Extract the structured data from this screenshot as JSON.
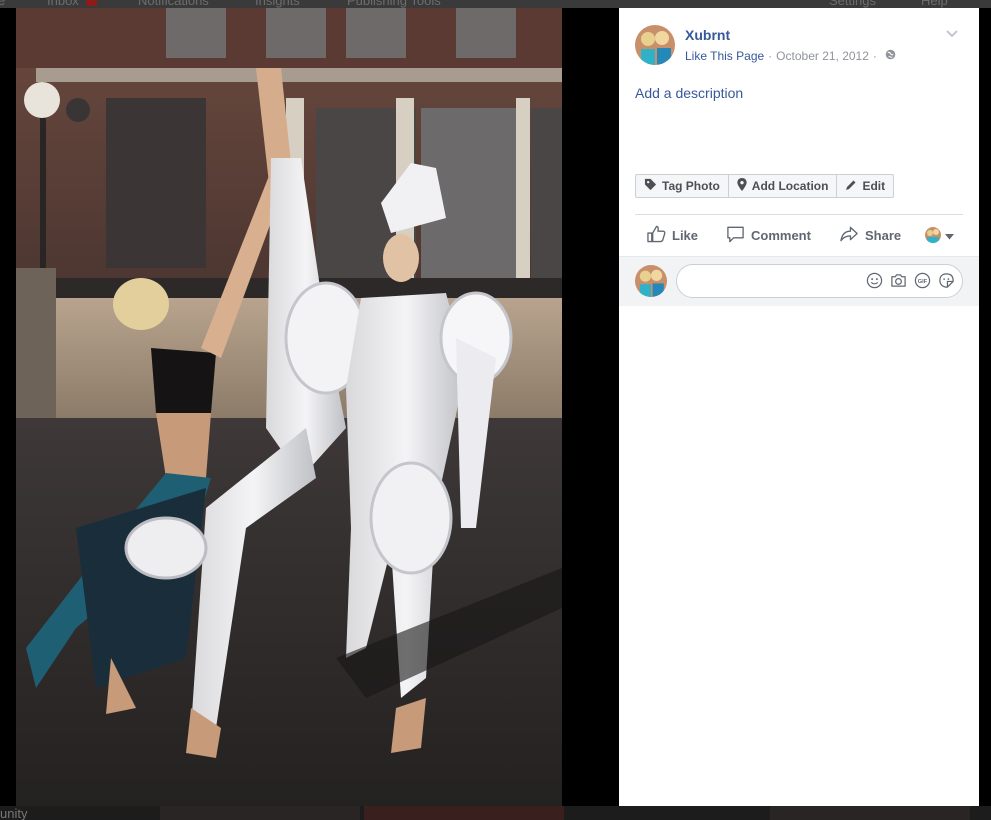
{
  "background": {
    "topbar_items": [
      "e",
      "Inbox",
      "Notifications",
      "Insights",
      "Publishing Tools",
      "Settings",
      "Help"
    ],
    "bottom_text": "unity"
  },
  "photo": {
    "alt": "Photo of three dancers in white costumes outside a building"
  },
  "panel": {
    "page_name": "Xubrnt",
    "like_link": "Like This Page",
    "separator": "·",
    "date": "October 21, 2012",
    "add_description": "Add a description",
    "tag_buttons": {
      "tag_photo": "Tag Photo",
      "add_location": "Add Location",
      "edit": "Edit"
    },
    "actions": {
      "like": "Like",
      "comment": "Comment",
      "share": "Share"
    },
    "comment_placeholder": ""
  },
  "colors": {
    "link_blue": "#365899",
    "meta_gray": "#90949c",
    "action_gray": "#606770",
    "panel_bg": "#ffffff",
    "comment_bg": "#f2f3f5"
  },
  "icons": [
    "chevron-down-icon",
    "globe-icon",
    "tag-icon",
    "location-pin-icon",
    "pencil-icon",
    "thumbs-up-icon",
    "comment-icon",
    "share-icon",
    "audience-dropdown-icon",
    "emoji-icon",
    "camera-icon",
    "gif-icon",
    "sticker-icon"
  ]
}
